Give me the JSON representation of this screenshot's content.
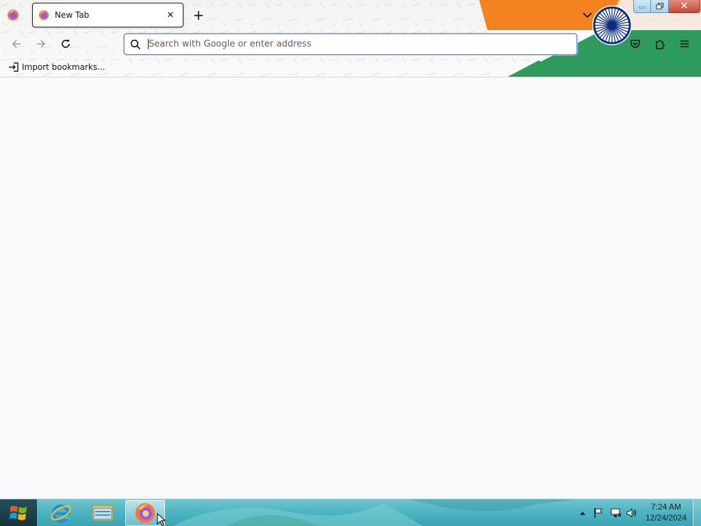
{
  "browser": {
    "tab": {
      "title": "New Tab",
      "close_glyph": "✕"
    },
    "new_tab_glyph": "+",
    "window_controls": {
      "close_glyph": "✕"
    },
    "urlbar": {
      "placeholder": "Search with Google or enter address",
      "value": ""
    },
    "bookmarks": {
      "import_label": "Import bookmarks..."
    },
    "icons": [
      "firefox-view-icon",
      "back-arrow-icon",
      "forward-arrow-icon",
      "reload-icon",
      "search-icon",
      "pocket-icon",
      "extensions-icon",
      "hamburger-menu-icon",
      "list-all-tabs-icon",
      "import-icon"
    ]
  },
  "taskbar": {
    "apps": [
      "internet-explorer",
      "file-explorer",
      "firefox"
    ],
    "active_app": "firefox",
    "clock": {
      "time": "7:24 AM",
      "date": "12/24/2024"
    }
  },
  "theme": {
    "saffron": "#f58220",
    "green": "#2e9a5e",
    "chakra_blue": "#0a2a7a",
    "accent": "#0061e0"
  }
}
